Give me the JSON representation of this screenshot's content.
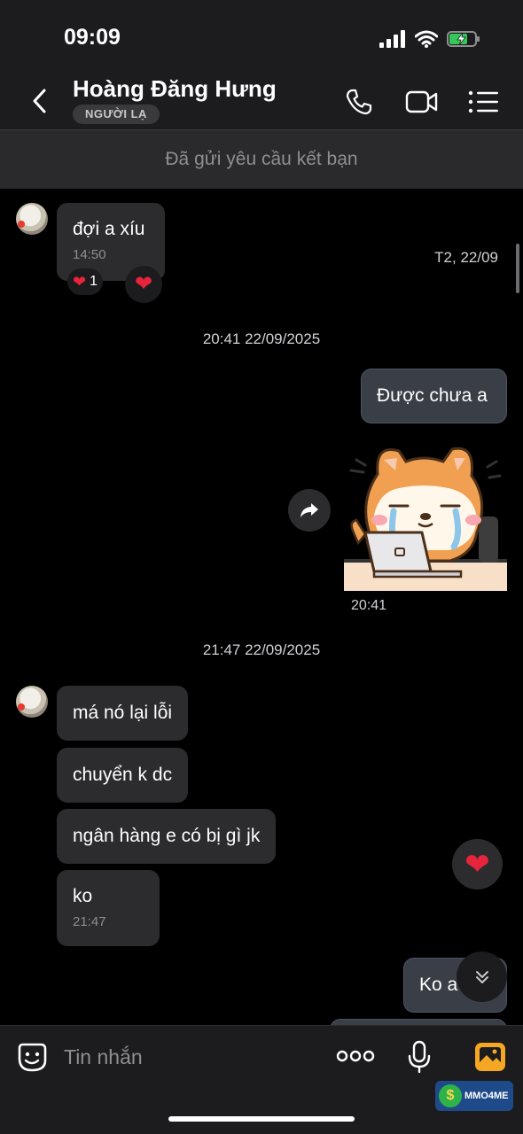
{
  "status": {
    "time": "09:09"
  },
  "header": {
    "contact_name": "Hoàng Đăng Hưng",
    "badge": "NGƯỜI LẠ",
    "icons": [
      "back-arrow-icon",
      "phone-icon",
      "video-camera-icon",
      "menu-list-icon"
    ]
  },
  "friend_request": {
    "text": "Đã gửi yêu cầu kết bạn"
  },
  "chat": {
    "messages": [
      {
        "side": "in",
        "text": "đợi a xíu",
        "time": "14:50",
        "reaction_count": "1"
      },
      {
        "side": "date",
        "text": "T2, 22/09"
      },
      {
        "side": "timestamp",
        "text": "20:41 22/09/2025"
      },
      {
        "side": "out",
        "text": "Được chưa a"
      },
      {
        "side": "out-sticker",
        "sticker": "crying-shiba-laptop-sticker",
        "time": "20:41"
      },
      {
        "side": "timestamp",
        "text": "21:47 22/09/2025"
      },
      {
        "side": "in",
        "text": "má nó lại lỗi"
      },
      {
        "side": "in",
        "text": "chuyển k dc"
      },
      {
        "side": "in",
        "text": "ngân hàng e có bị gì jk"
      },
      {
        "side": "in",
        "text": "ko",
        "time": "21:47"
      },
      {
        "side": "out",
        "text": "Ko a"
      }
    ]
  },
  "input": {
    "placeholder": "Tin nhắn",
    "icons": [
      "emoji-icon",
      "more-icon",
      "microphone-icon",
      "image-icon"
    ]
  },
  "watermark": {
    "text": "MMO4ME",
    "symbol": "$"
  },
  "colors": {
    "background": "#000000",
    "bar": "#1c1c1e",
    "incoming_bubble": "#2c2c2e",
    "outgoing_bubble": "#3a3f47",
    "heart": "#e8243c",
    "image_icon": "#f5a623"
  }
}
